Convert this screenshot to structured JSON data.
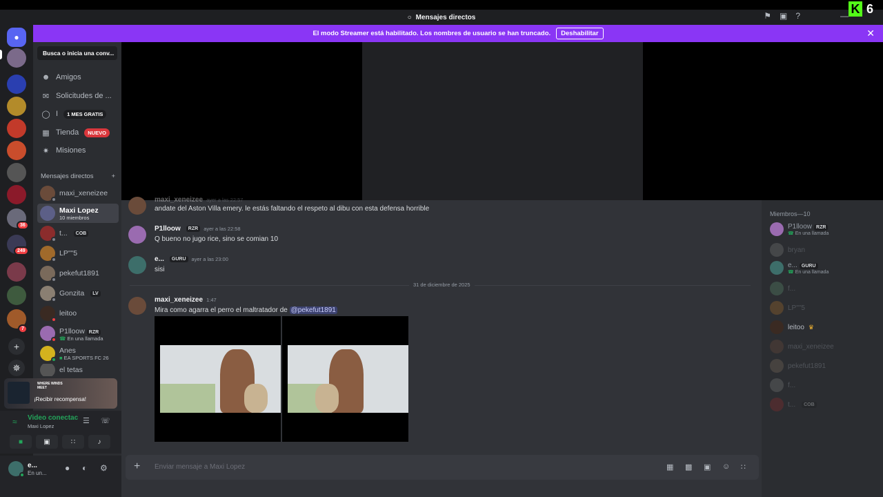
{
  "window": {
    "title": "Mensajes directos",
    "kick_count": "6"
  },
  "banner": {
    "text": "El modo Streamer está habilitado. Los nombres de usuario se han truncado.",
    "button": "Deshabilitar"
  },
  "server_badges": [
    "36",
    "249",
    "7"
  ],
  "sidebar": {
    "search": "Busca o inicia una conv...",
    "nav": [
      {
        "label": "Amigos",
        "icon": "friends-icon"
      },
      {
        "label": "Solicitudes de ...",
        "icon": "mail-icon"
      },
      {
        "label": "I",
        "icon": "nitro-icon",
        "tag": "1 MES GRATIS"
      },
      {
        "label": "Tienda",
        "icon": "shop-icon",
        "tag": "NUEVO"
      },
      {
        "label": "Misiones",
        "icon": "quests-icon"
      }
    ],
    "dm_header": "Mensajes directos",
    "dms": [
      {
        "name": "maxi_xeneizee",
        "sub": "",
        "tag": "",
        "color": "#6a4b3a"
      },
      {
        "name": "Maxi Lopez",
        "sub": "10 miembros",
        "tag": "",
        "color": "#5c5f87"
      },
      {
        "name": "t...",
        "sub": "",
        "tag": "COB",
        "color": "#8b2c2c"
      },
      {
        "name": "LP\"\"5",
        "sub": "",
        "tag": "",
        "color": "#a06a2b"
      },
      {
        "name": "pekefut1891",
        "sub": "",
        "tag": "",
        "color": "#7a6a5b"
      },
      {
        "name": "Gonzita",
        "sub": "",
        "tag": "LV",
        "color": "#8a7f72"
      },
      {
        "name": "leitoo",
        "sub": "",
        "tag": "",
        "color": "#3a2a22"
      },
      {
        "name": "P1lloow",
        "sub": "En una llamada",
        "tag": "RZR",
        "color": "#9a6bb0"
      },
      {
        "name": "Anes",
        "sub": "EA SPORTS FC 26",
        "tag": "",
        "color": "#d4b21e"
      },
      {
        "name": "el tetas",
        "sub": "",
        "tag": "",
        "color": "#555"
      }
    ]
  },
  "promo": {
    "logo": "WHERE WINDS MEET",
    "text": "¡Recibir recompensa!"
  },
  "voice": {
    "status": "Video conectac",
    "channel": "Maxi Lopez"
  },
  "user": {
    "name": "e...",
    "status": "En un..."
  },
  "messages": [
    {
      "author": "maxi_xeneizee",
      "time": "ayer a las 22:57",
      "tag": "",
      "text": "andate del Aston Villa emery. le estás faltando el respeto al dibu con esta defensa horrible",
      "color": "#6a4b3a"
    },
    {
      "author": "P1lloow",
      "time": "ayer a las 22:58",
      "tag": "RZR",
      "text": "Q bueno no jugo rice, sino se comian 10",
      "color": "#9a6bb0"
    },
    {
      "author": "e...",
      "time": "ayer a las 23:00",
      "tag": "GURU",
      "text": "sisi",
      "color": "#3d6e6a"
    },
    {
      "author": "maxi_xeneizee",
      "time": "1:47",
      "tag": "",
      "text": "Mira como agarra el perro el maltratador de ",
      "mention": "@pekefut1891",
      "color": "#6a4b3a"
    }
  ],
  "date_divider": "31 de diciembre de 2025",
  "composer": {
    "placeholder": "Enviar mensaje a Maxi Lopez"
  },
  "members": {
    "header": "Miembros—10",
    "list": [
      {
        "name": "P1lloow",
        "status": "En una llamada",
        "tag": "RZR",
        "dim": false
      },
      {
        "name": "bryan",
        "status": "",
        "tag": "",
        "dim": true
      },
      {
        "name": "e...",
        "status": "En una llamada",
        "tag": "GURU",
        "dim": false
      },
      {
        "name": "f...",
        "status": "",
        "tag": "",
        "dim": true
      },
      {
        "name": "LP\"\"5",
        "status": "",
        "tag": "",
        "dim": true
      },
      {
        "name": "leitoo",
        "status": "",
        "tag": "",
        "dim": false
      },
      {
        "name": "maxi_xeneizee",
        "status": "",
        "tag": "",
        "dim": true
      },
      {
        "name": "pekefut1891",
        "status": "",
        "tag": "",
        "dim": true
      },
      {
        "name": "f...",
        "status": "",
        "tag": "",
        "dim": true
      },
      {
        "name": "t...",
        "status": "",
        "tag": "COB",
        "dim": true
      }
    ]
  },
  "colors": {
    "brand": "#5865f2",
    "streamer_banner": "#8a36f5",
    "online": "#23a55a",
    "danger": "#f23f43"
  }
}
